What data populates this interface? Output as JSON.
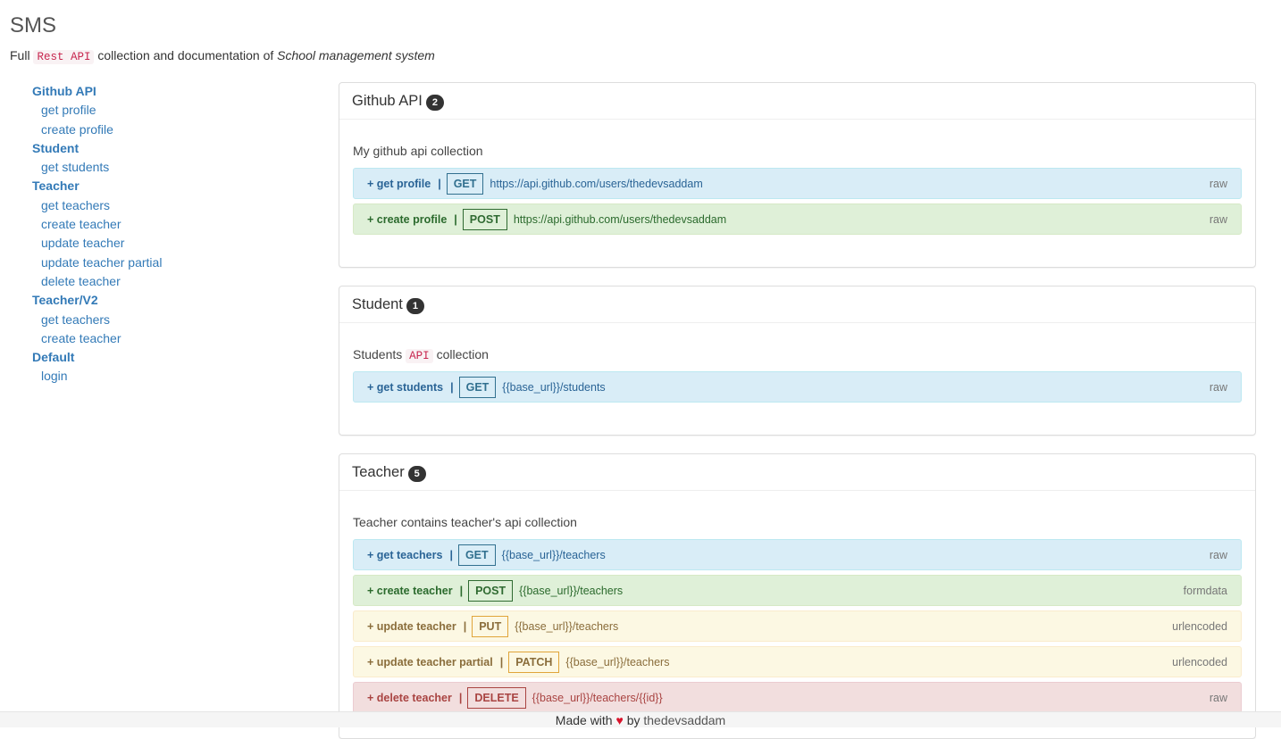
{
  "header": {
    "title": "SMS",
    "desc_prefix": "Full",
    "desc_code": "Rest API",
    "desc_middle": "collection and documentation of",
    "desc_em": "School management system"
  },
  "sidebar": {
    "groups": [
      {
        "title": "Github API",
        "items": [
          "get profile",
          "create profile"
        ]
      },
      {
        "title": "Student",
        "items": [
          "get students"
        ]
      },
      {
        "title": "Teacher",
        "items": [
          "get teachers",
          "create teacher",
          "update teacher",
          "update teacher partial",
          "delete teacher"
        ]
      },
      {
        "title": "Teacher/V2",
        "items": [
          "get teachers",
          "create teacher"
        ]
      },
      {
        "title": "Default",
        "items": [
          "login"
        ]
      }
    ]
  },
  "panels": [
    {
      "title": "Github API",
      "count": "2",
      "desc": "My github api collection",
      "requests": [
        {
          "name": "get profile",
          "method": "GET",
          "url": "https://api.github.com/users/thedevsaddam",
          "mode": "raw"
        },
        {
          "name": "create profile",
          "method": "POST",
          "url": "https://api.github.com/users/thedevsaddam",
          "mode": "raw"
        }
      ]
    },
    {
      "title": "Student",
      "count": "1",
      "desc_prefix": "Students",
      "desc_code": "API",
      "desc_suffix": "collection",
      "requests": [
        {
          "name": "get students",
          "method": "GET",
          "url": "{{base_url}}/students",
          "mode": "raw"
        }
      ]
    },
    {
      "title": "Teacher",
      "count": "5",
      "desc": "Teacher contains teacher's api collection",
      "requests": [
        {
          "name": "get teachers",
          "method": "GET",
          "url": "{{base_url}}/teachers",
          "mode": "raw"
        },
        {
          "name": "create teacher",
          "method": "POST",
          "url": "{{base_url}}/teachers",
          "mode": "formdata"
        },
        {
          "name": "update teacher",
          "method": "PUT",
          "url": "{{base_url}}/teachers",
          "mode": "urlencoded"
        },
        {
          "name": "update teacher partial",
          "method": "PATCH",
          "url": "{{base_url}}/teachers",
          "mode": "urlencoded"
        },
        {
          "name": "delete teacher",
          "method": "DELETE",
          "url": "{{base_url}}/teachers/{{id}}",
          "mode": "raw"
        }
      ]
    }
  ],
  "footer": {
    "prefix": "Made with",
    "heart": "♥",
    "by": "by",
    "author": "thedevsaddam"
  },
  "colors": {
    "link": "#337ab7",
    "get": "#d9edf7",
    "post": "#dff0d8",
    "put_patch": "#fcf8e3",
    "delete": "#f2dede"
  }
}
